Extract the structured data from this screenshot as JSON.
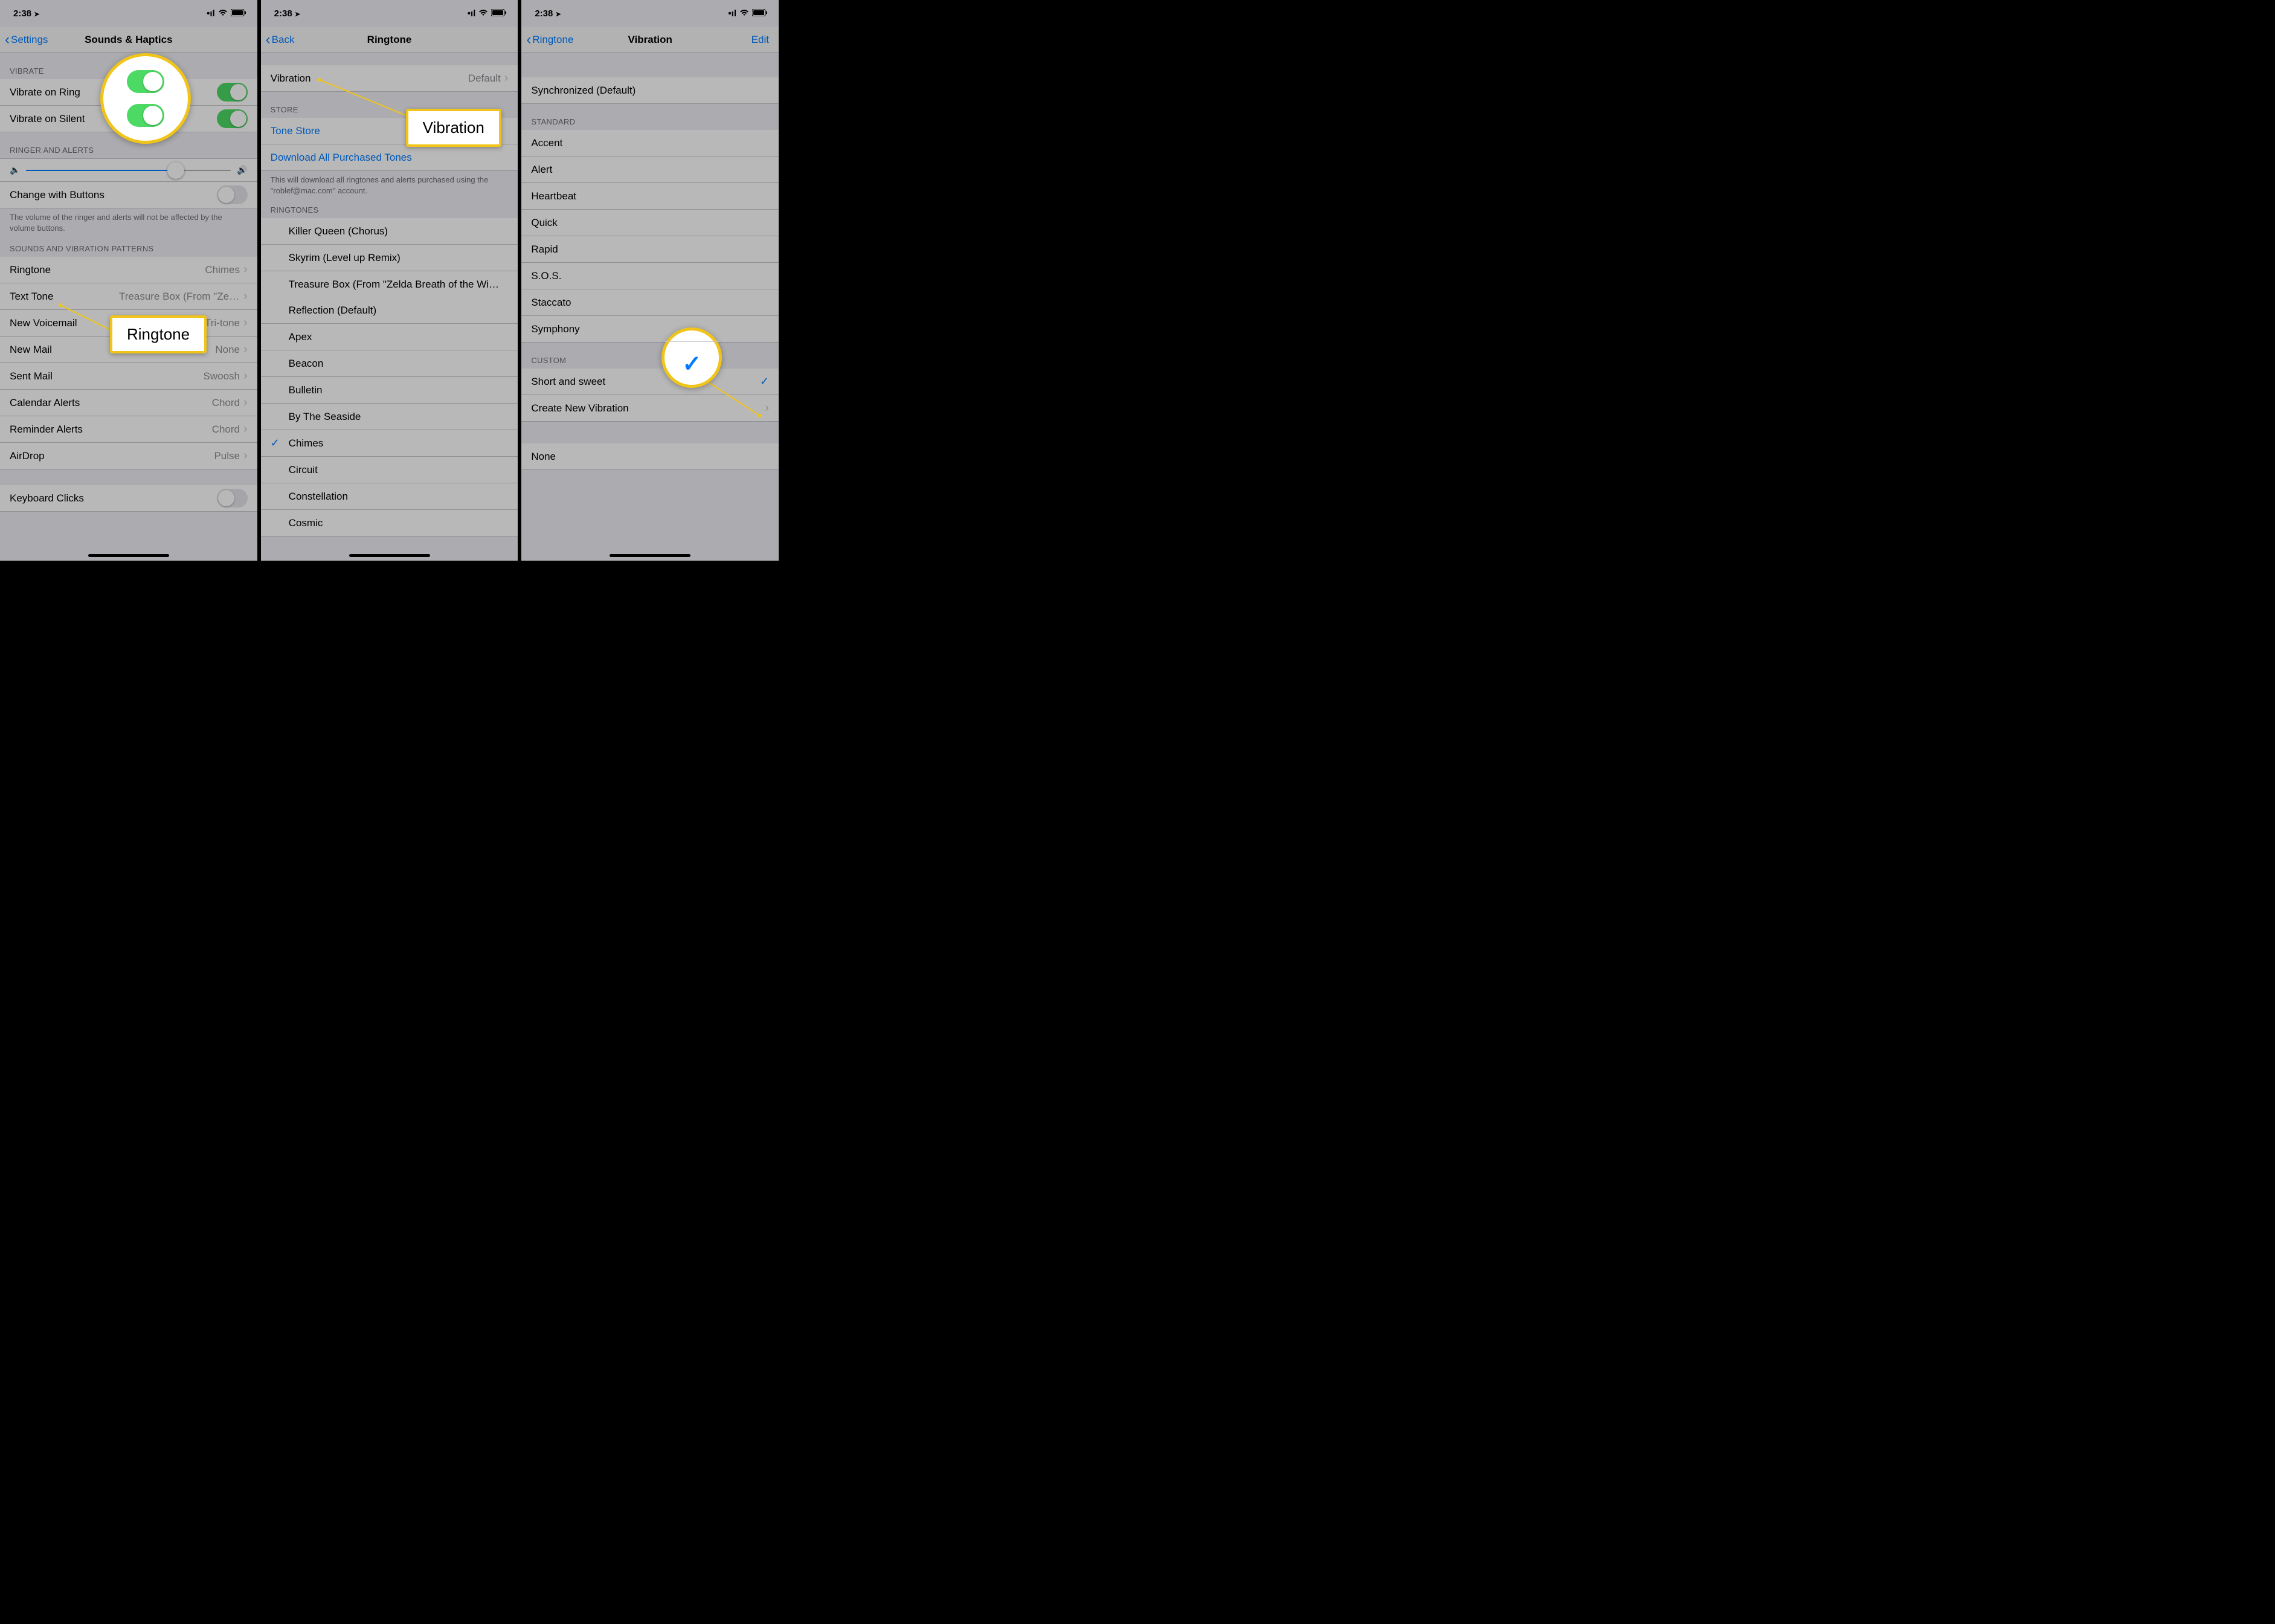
{
  "status": {
    "time": "2:38",
    "loc_glyph": "➤",
    "signal": "•ıl",
    "wifi": "⧋",
    "battery": "▮▮"
  },
  "screen1": {
    "back": "Settings",
    "title": "Sounds & Haptics",
    "sections": {
      "vibrate": {
        "header": "VIBRATE",
        "rows": [
          {
            "label": "Vibrate on Ring",
            "on": true
          },
          {
            "label": "Vibrate on Silent",
            "on": true
          }
        ]
      },
      "ringer": {
        "header": "RINGER AND ALERTS",
        "slider_pct": 73,
        "change_buttons": {
          "label": "Change with Buttons",
          "on": false
        },
        "footer": "The volume of the ringer and alerts will not be affected by the volume buttons."
      },
      "patterns": {
        "header": "SOUNDS AND VIBRATION PATTERNS",
        "rows": [
          {
            "label": "Ringtone",
            "value": "Chimes"
          },
          {
            "label": "Text Tone",
            "value": "Treasure Box (From \"Zelda Breath…"
          },
          {
            "label": "New Voicemail",
            "value": "Tri-tone"
          },
          {
            "label": "New Mail",
            "value": "None"
          },
          {
            "label": "Sent Mail",
            "value": "Swoosh"
          },
          {
            "label": "Calendar Alerts",
            "value": "Chord"
          },
          {
            "label": "Reminder Alerts",
            "value": "Chord"
          },
          {
            "label": "AirDrop",
            "value": "Pulse"
          }
        ]
      },
      "keyboard": {
        "label": "Keyboard Clicks",
        "on": false
      }
    },
    "callout": "Ringtone"
  },
  "screen2": {
    "back": "Back",
    "title": "Ringtone",
    "vibration": {
      "label": "Vibration",
      "value": "Default"
    },
    "store": {
      "header": "STORE",
      "tone_store": "Tone Store",
      "download": "Download All Purchased Tones",
      "footer": "This will download all ringtones and alerts purchased using the \"roblef@mac.com\" account."
    },
    "ringtones": {
      "header": "RINGTONES",
      "custom": [
        "Killer Queen (Chorus)",
        "Skyrim (Level up Remix)",
        "Treasure Box (From \"Zelda Breath of the Wi…"
      ],
      "builtin_default": "Reflection (Default)",
      "builtin": [
        "Apex",
        "Beacon",
        "Bulletin",
        "By The Seaside",
        "Chimes",
        "Circuit",
        "Constellation",
        "Cosmic"
      ],
      "selected": "Chimes"
    },
    "callout": "Vibration"
  },
  "screen3": {
    "back": "Ringtone",
    "title": "Vibration",
    "edit": "Edit",
    "sync": "Synchronized (Default)",
    "standard": {
      "header": "STANDARD",
      "items": [
        "Accent",
        "Alert",
        "Heartbeat",
        "Quick",
        "Rapid",
        "S.O.S.",
        "Staccato",
        "Symphony"
      ]
    },
    "custom": {
      "header": "CUSTOM",
      "selected": "Short and sweet",
      "create": "Create New Vibration"
    },
    "none": "None"
  }
}
